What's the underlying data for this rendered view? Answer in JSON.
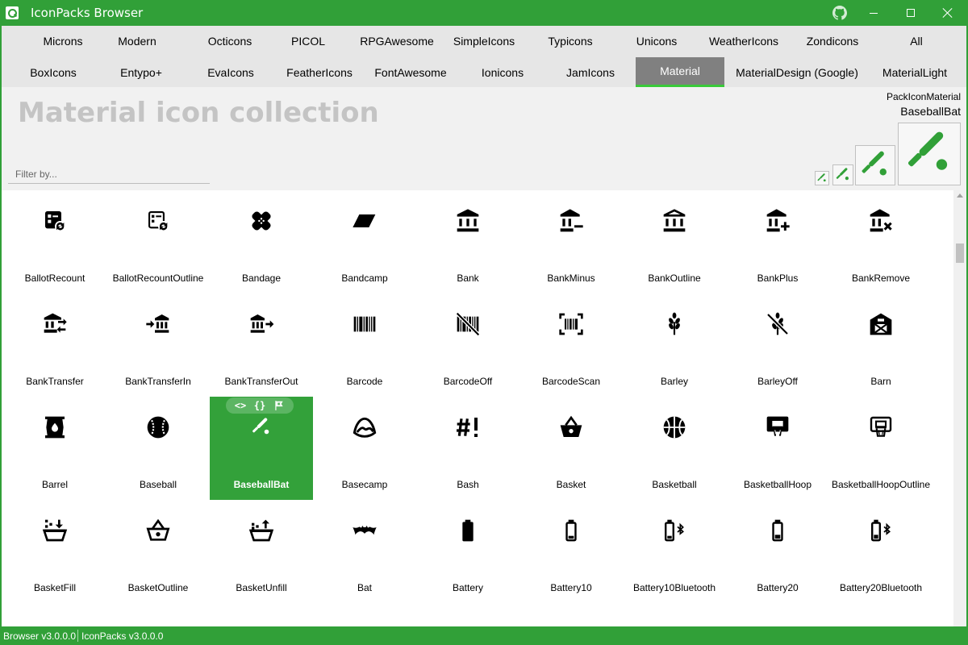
{
  "window": {
    "title": "IconPacks Browser"
  },
  "tabs_row1": [
    "Microns",
    "Modern",
    "Octicons",
    "PICOL",
    "RPGAwesome",
    "SimpleIcons",
    "Typicons",
    "Unicons",
    "WeatherIcons",
    "Zondicons",
    "All"
  ],
  "tabs_row2": [
    "BoxIcons",
    "Entypo+",
    "EvaIcons",
    "FeatherIcons",
    "FontAwesome",
    "Ionicons",
    "JamIcons",
    "Material",
    "MaterialDesign (Google)",
    "MaterialLight"
  ],
  "active_tab": "Material",
  "header": {
    "title": "Material icon collection",
    "filter_placeholder": "Filter by...",
    "pack_name": "PackIconMaterial",
    "selected_icon": "BaseballBat"
  },
  "icons": [
    [
      "BallotRecount",
      "BallotRecountOutline",
      "Bandage",
      "Bandcamp",
      "Bank",
      "BankMinus",
      "BankOutline",
      "BankPlus",
      "BankRemove"
    ],
    [
      "BankTransfer",
      "BankTransferIn",
      "BankTransferOut",
      "Barcode",
      "BarcodeOff",
      "BarcodeScan",
      "Barley",
      "BarleyOff",
      "Barn"
    ],
    [
      "Barrel",
      "Baseball",
      "BaseballBat",
      "Basecamp",
      "Bash",
      "Basket",
      "Basketball",
      "BasketballHoop",
      "BasketballHoopOutline"
    ],
    [
      "BasketFill",
      "BasketOutline",
      "BasketUnfill",
      "Bat",
      "Battery",
      "Battery10",
      "Battery10Bluetooth",
      "Battery20",
      "Battery20Bluetooth"
    ]
  ],
  "selected_overlay": {
    "xaml": "<>",
    "code": "{}",
    "flag": "flag-icon"
  },
  "status": {
    "browser_version": "Browser v3.0.0.0",
    "iconpacks_version": "IconPacks v3.0.0.0"
  },
  "colors": {
    "accent": "#31a038",
    "selected": "#33a13a",
    "active_tab": "#808080",
    "active_underline": "#39ca39"
  }
}
